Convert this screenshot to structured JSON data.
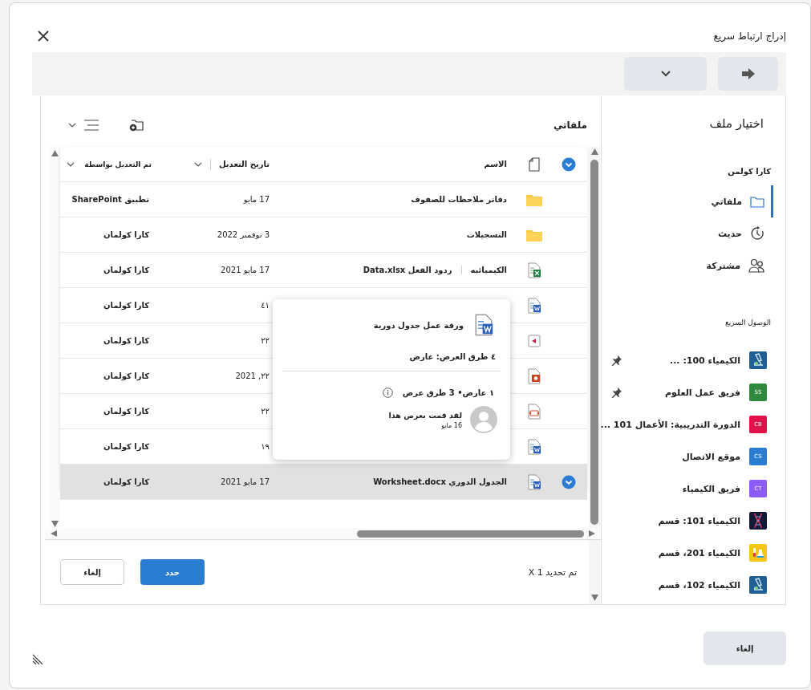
{
  "dialog": {
    "title": "إدراج ارتباط سريع"
  },
  "sidebar": {
    "title": "اختيار ملف",
    "account": "كارا كولمن",
    "nav": [
      {
        "label": "ملفاتي",
        "kind": "folder",
        "selected": true
      },
      {
        "label": "حديث",
        "kind": "clock",
        "selected": false
      },
      {
        "label": "مشتركة",
        "kind": "people",
        "selected": false
      }
    ],
    "quick_access_title": "الوصول السريع",
    "quick_access": [
      {
        "label": "الكيمياء 100: ...",
        "kind": "microscope",
        "pinned": true
      },
      {
        "label": "فريق عمل العلوم",
        "kind": "initials",
        "initials": "SS",
        "color": "#2f8a3e",
        "pinned": true
      },
      {
        "label": "الدورة التدريبية: الأعمال 101 ...",
        "kind": "initials",
        "initials": "CB",
        "color": "#e0124a",
        "pinned": false
      },
      {
        "label": "موقع الاتصال",
        "kind": "initials",
        "initials": "CS",
        "color": "#2b7cd3",
        "pinned": false
      },
      {
        "label": "فريق الكيمياء",
        "kind": "initials",
        "initials": "CT",
        "color": "#8b5cf6",
        "pinned": false
      },
      {
        "label": "الكيمياء 101: قسم",
        "kind": "dna",
        "pinned": false
      },
      {
        "label": "الكيمياء 201، قسم",
        "kind": "flask",
        "pinned": false
      },
      {
        "label": "الكيمياء 102، قسم",
        "kind": "microscope",
        "pinned": false
      }
    ]
  },
  "files": {
    "title": "ملفاتي",
    "columns": [
      "الاسم",
      "تاريخ التعديل",
      "تم التعديل بواسطة"
    ],
    "rows": [
      {
        "kind": "folder",
        "name": "دفاتر ملاحظات للصفوف",
        "date": "17 مايو",
        "modified_by": "تطبيق SharePoint",
        "selected": false
      },
      {
        "kind": "folder",
        "name": "التسجيلات",
        "date": "3 نوفمبر 2022",
        "modified_by": "كارا كولمان",
        "selected": false
      },
      {
        "kind": "excel",
        "path": "الكيميائيه",
        "name": "ردود الفعل Data.xlsx",
        "date": "17 مايو 2021",
        "modified_by": "كارا كولمان",
        "selected": false
      },
      {
        "kind": "word",
        "date": "٤١",
        "modified_by": "كارا كولمان",
        "selected": false
      },
      {
        "kind": "media",
        "date": "٢٢",
        "modified_by": "كارا كولمان",
        "selected": false
      },
      {
        "kind": "powerpoint",
        "date": "٢٢, 2021",
        "modified_by": "كارا كولمان",
        "selected": false
      },
      {
        "kind": "video",
        "date": "٢٢",
        "modified_by": "كارا كولمان",
        "selected": false
      },
      {
        "kind": "word",
        "date": "١٩",
        "modified_by": "كارا كولمان",
        "selected": false
      },
      {
        "kind": "word",
        "name": "الجدول الدوري Worksheet.docx",
        "date": "17 مايو 2021",
        "modified_by": "كارا كولمان",
        "selected": true
      }
    ],
    "card": {
      "title": "ورقة عمل جدول دورية",
      "views_link": "٤ طرق العرض: عارض",
      "stats": "١ عارض• 3 طرق عرض",
      "activity": "لقد قمت بعرض هذا",
      "activity_date": "16 مايو"
    },
    "footer": {
      "selection": "تم تحديد 1 X",
      "primary": "حدد",
      "cancel": "إلغاء"
    }
  },
  "bottom": {
    "cancel": "إلغاء"
  }
}
